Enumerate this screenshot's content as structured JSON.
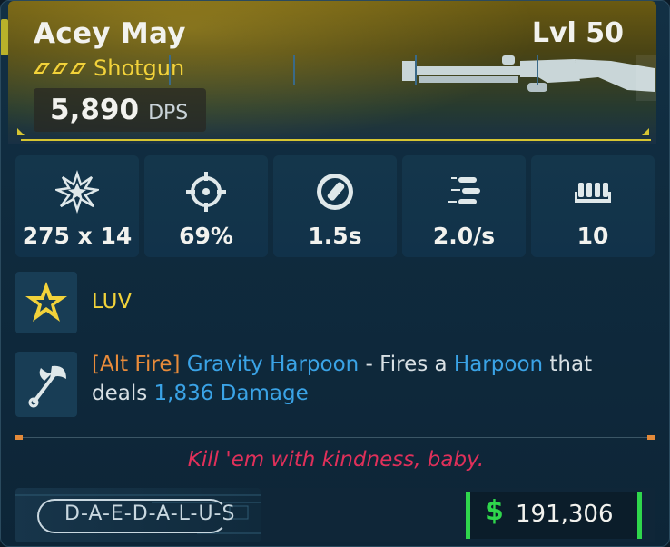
{
  "weapon": {
    "name": "Acey May",
    "level": "Lvl 50",
    "type": "Shotgun",
    "dps_value": "5,890",
    "dps_unit": "DPS",
    "rarity_color": "#f2d23a"
  },
  "stats": [
    {
      "icon": "burst-damage-icon",
      "value": "275 x 14"
    },
    {
      "icon": "crosshair-accuracy-icon",
      "value": "69%"
    },
    {
      "icon": "reload-time-icon",
      "value": "1.5s"
    },
    {
      "icon": "fire-rate-icon",
      "value": "2.0/s"
    },
    {
      "icon": "magazine-ammo-icon",
      "value": "10"
    }
  ],
  "perks": {
    "perk1": {
      "icon": "star-badge-icon",
      "label": "LUV"
    },
    "perk2": {
      "icon": "harpoon-axe-icon",
      "alt_tag": "[Alt Fire]",
      "ability": "Gravity Harpoon",
      "sep": " - Fires a ",
      "harpoon": "Harpoon",
      "that": " that",
      "deals": "deals ",
      "damage": "1,836 Damage"
    }
  },
  "flavor_text": "Kill 'em with kindness, baby.",
  "footer": {
    "manufacturer": "D-A-E-D-A-L-U-S",
    "currency_symbol": "$",
    "price": "191,306"
  },
  "colors": {
    "accent_yellow": "#d6c532",
    "ability_blue": "#3aa3e6",
    "alt_orange": "#e88b3a",
    "flavor_red": "#e0305a",
    "price_green": "#2fd64c"
  }
}
